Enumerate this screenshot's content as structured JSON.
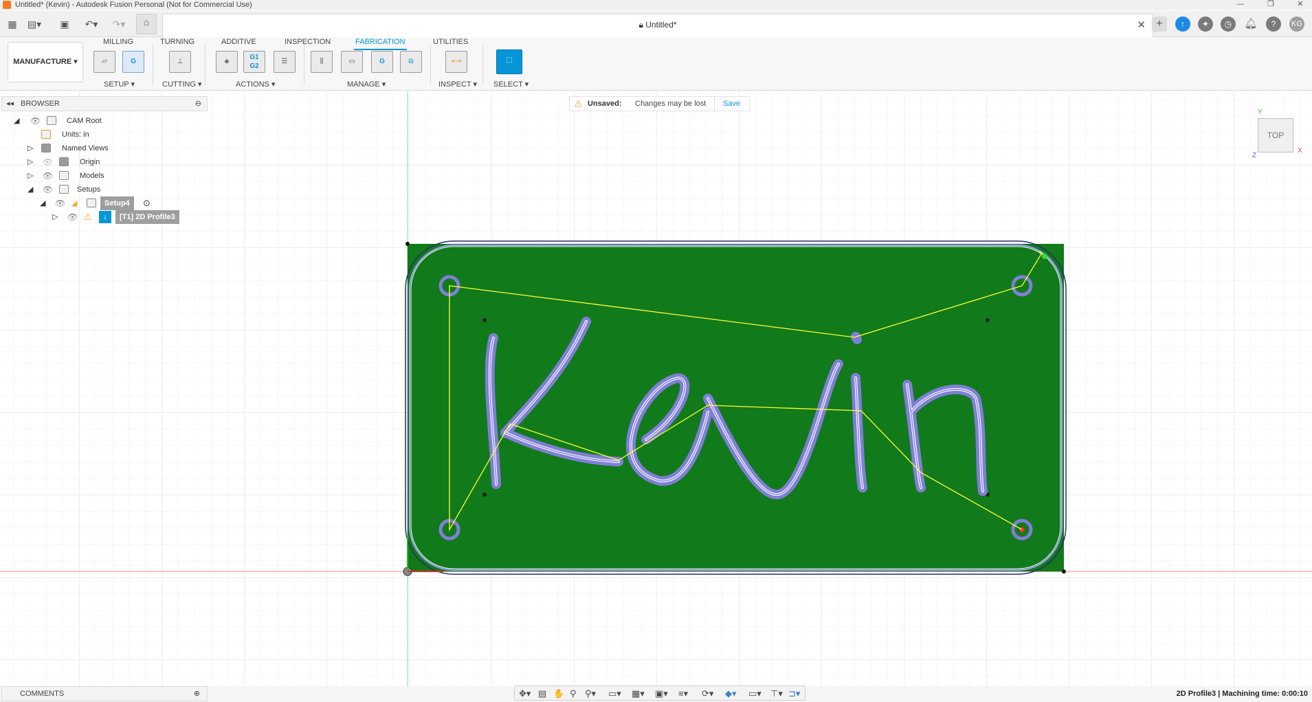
{
  "window": {
    "title": "Untitled* (Kevin) - Autodesk Fusion Personal (Not for Commercial Use)",
    "doc_tab_title": "Untitled*",
    "user_initials": "KG"
  },
  "ribbon": {
    "workspace": "MANUFACTURE",
    "tabs": [
      "MILLING",
      "TURNING",
      "ADDITIVE",
      "INSPECTION",
      "FABRICATION",
      "UTILITIES"
    ],
    "active_tab": "FABRICATION",
    "groups": {
      "setup": "SETUP",
      "cutting": "CUTTING",
      "actions": "ACTIONS",
      "manage": "MANAGE",
      "inspect": "INSPECT",
      "select": "SELECT"
    },
    "icon_text": {
      "g_code": "G",
      "g1g2_top": "G1",
      "g1g2_bottom": "G2"
    }
  },
  "browser": {
    "title": "BROWSER",
    "items": {
      "cam_root": "CAM Root",
      "units": "Units: in",
      "named_views": "Named Views",
      "origin": "Origin",
      "models": "Models",
      "setups": "Setups",
      "setup4": "Setup4",
      "operation": "[T1] 2D Profile3"
    }
  },
  "notification": {
    "label": "Unsaved:",
    "message": "Changes may be lost",
    "action": "Save"
  },
  "viewcube": {
    "face": "TOP",
    "axis_y": "Y",
    "axis_x": "X",
    "axis_z": "Z"
  },
  "comments": {
    "title": "COMMENTS"
  },
  "status": {
    "text": "2D Profile3 | Machining time: 0:00:10"
  },
  "colors": {
    "accent": "#0696d7",
    "stock_green": "#117a1a",
    "toolpath_yellow": "#ffff33",
    "warning": "#f5a623",
    "toolpath_outline": "#7f7fd6"
  }
}
